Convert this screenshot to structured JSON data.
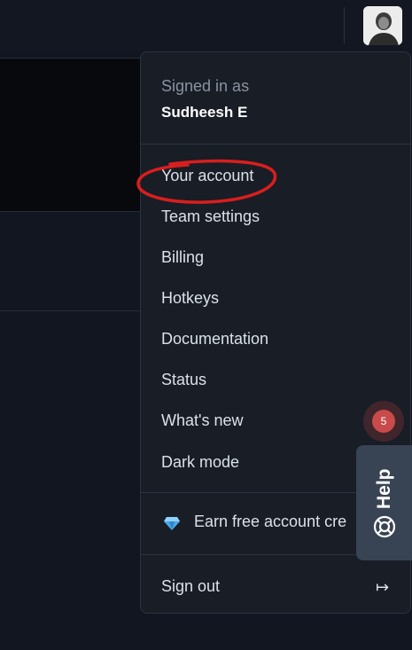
{
  "header": {
    "avatar_alt": "user avatar"
  },
  "user_menu": {
    "signed_in_label": "Signed in as",
    "user_name": "Sudheesh E",
    "items": [
      {
        "label": "Your account"
      },
      {
        "label": "Team settings"
      },
      {
        "label": "Billing"
      },
      {
        "label": "Hotkeys"
      },
      {
        "label": "Documentation"
      },
      {
        "label": "Status"
      },
      {
        "label": "What's new"
      },
      {
        "label": "Dark mode"
      }
    ],
    "credits_label": "Earn free account cre",
    "credits_icon": "gem-icon",
    "sign_out_label": "Sign out",
    "sign_out_icon": "↦"
  },
  "notification": {
    "count": "5"
  },
  "help_widget": {
    "label": "Help",
    "icon": "lifebuoy-icon"
  },
  "colors": {
    "background": "#111620",
    "menu_background": "#181d26",
    "annotation_red": "#d91e1e",
    "notification_red": "#c94a4a",
    "help_tab": "#384354"
  }
}
